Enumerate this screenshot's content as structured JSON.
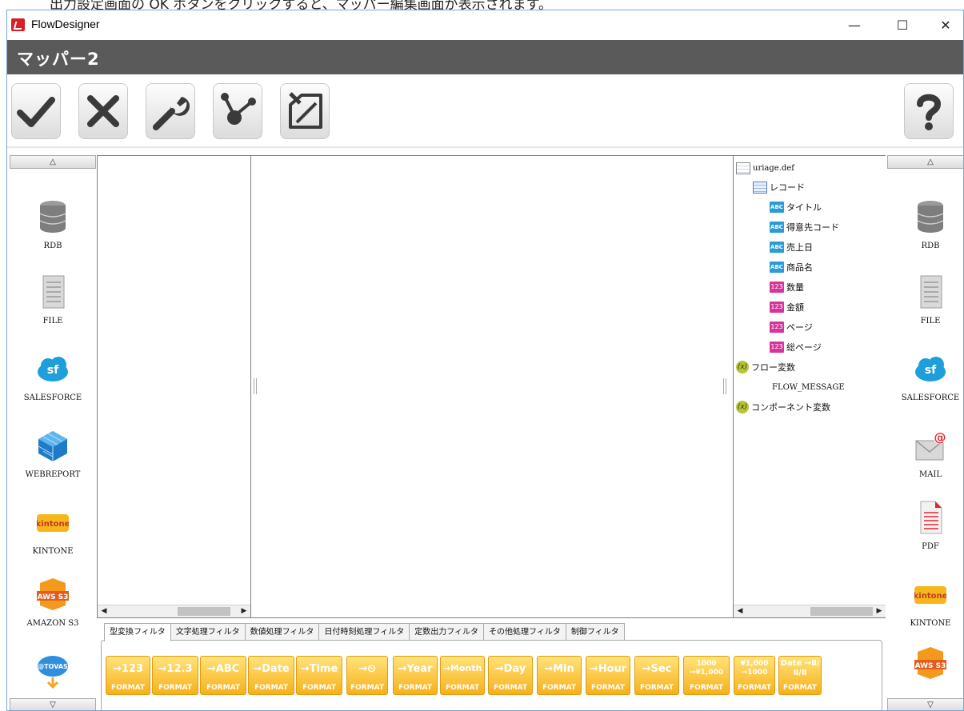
{
  "caption": "出力設定画面の OK ボタンをクリックすると、マッパー編集画面が表示されます。",
  "window": {
    "title": "FlowDesigner",
    "minimize": "—",
    "maximize": "☐",
    "close": "✕"
  },
  "header": {
    "title": "マッパー2"
  },
  "toolbar": {
    "icons": [
      "check-icon",
      "cross-icon",
      "wrench-icon",
      "branch-icon",
      "tag-edit-icon",
      "help-icon"
    ]
  },
  "left_palette": {
    "up": "△",
    "down": "▽",
    "items": [
      {
        "label": "RDB",
        "icon": "database-icon"
      },
      {
        "label": "FILE",
        "icon": "file-icon"
      },
      {
        "label": "SALESFORCE",
        "icon": "salesforce-icon",
        "logo_text": "sf"
      },
      {
        "label": "WEBREPORT",
        "icon": "cube-icon"
      },
      {
        "label": "KINTONE",
        "icon": "kintone-icon",
        "logo_text": "kintone"
      },
      {
        "label": "AMAZON S3",
        "icon": "aws-s3-icon",
        "logo_text": "AWS S3"
      },
      {
        "label": "",
        "icon": "tovas-icon",
        "logo_text": "@TOVAS"
      }
    ]
  },
  "right_palette": {
    "up": "△",
    "down": "▽",
    "items": [
      {
        "label": "RDB",
        "icon": "database-icon"
      },
      {
        "label": "FILE",
        "icon": "file-icon"
      },
      {
        "label": "SALESFORCE",
        "icon": "salesforce-icon",
        "logo_text": "sf"
      },
      {
        "label": "MAIL",
        "icon": "mail-icon"
      },
      {
        "label": "PDF",
        "icon": "pdf-icon"
      },
      {
        "label": "KINTONE",
        "icon": "kintone-icon",
        "logo_text": "kintone"
      },
      {
        "label": "",
        "icon": "aws-s3-icon",
        "logo_text": "AWS S3"
      }
    ]
  },
  "tree": {
    "root": "uriage.def",
    "record": "レコード",
    "fields": [
      {
        "type": "ABC",
        "name": "タイトル"
      },
      {
        "type": "ABC",
        "name": "得意先コード"
      },
      {
        "type": "ABC",
        "name": "売上日"
      },
      {
        "type": "ABC",
        "name": "商品名"
      },
      {
        "type": "123",
        "name": "数量"
      },
      {
        "type": "123",
        "name": "金額"
      },
      {
        "type": "123",
        "name": "ページ"
      },
      {
        "type": "123",
        "name": "総ページ"
      }
    ],
    "flow_vars": "フロー変数",
    "flow_message": "FLOW_MESSAGE",
    "component_vars": "コンポーネント変数",
    "var_glyph": "(x)"
  },
  "tabs": [
    "型変換フィルタ",
    "文字処理フィルタ",
    "数値処理フィルタ",
    "日付時刻処理フィルタ",
    "定数出力フィルタ",
    "その他処理フィルタ",
    "制御フィルタ"
  ],
  "filters": [
    {
      "top": "→123",
      "fmt": "FORMAT"
    },
    {
      "top": "→12.3",
      "fmt": "FORMAT"
    },
    {
      "top": "→ABC",
      "fmt": "FORMAT"
    },
    {
      "top": "→Date",
      "fmt": "FORMAT"
    },
    {
      "top": "→Time",
      "fmt": "FORMAT"
    },
    {
      "top": "→⏲",
      "fmt": "FORMAT"
    },
    {
      "top": "→Year",
      "fmt": "FORMAT"
    },
    {
      "top": "→Month",
      "fmt": "FORMAT"
    },
    {
      "top": "→Day",
      "fmt": "FORMAT"
    },
    {
      "top": "→Min",
      "fmt": "FORMAT"
    },
    {
      "top": "→Hour",
      "fmt": "FORMAT"
    },
    {
      "top": "→Sec",
      "fmt": "FORMAT"
    },
    {
      "top": "1000 →¥1,000",
      "fmt": "FORMAT"
    },
    {
      "top": "¥1,000 →1000",
      "fmt": "FORMAT"
    },
    {
      "top": "Date →Ⅱ/Ⅱ/Ⅱ",
      "fmt": "FORMAT"
    }
  ]
}
